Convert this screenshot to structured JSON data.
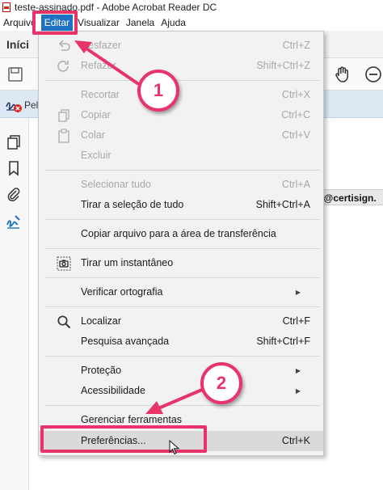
{
  "window": {
    "title": "teste-assinado.pdf - Adobe Acrobat Reader DC"
  },
  "menubar": {
    "items": [
      "Arquivo",
      "Editar",
      "Visualizar",
      "Janela",
      "Ajuda"
    ],
    "active": "Editar"
  },
  "toolbar": {
    "home_label": "Iníci",
    "sign_label": "Pel"
  },
  "document": {
    "email_fragment": "aro@certisign."
  },
  "dropdown": {
    "items": {
      "desfazer": {
        "label": "Desfazer",
        "shortcut": "Ctrl+Z"
      },
      "refazer": {
        "label": "Refazer",
        "shortcut": "Shift+Ctrl+Z"
      },
      "recortar": {
        "label": "Recortar",
        "shortcut": "Ctrl+X"
      },
      "copiar": {
        "label": "Copiar",
        "shortcut": "Ctrl+C"
      },
      "colar": {
        "label": "Colar",
        "shortcut": "Ctrl+V"
      },
      "excluir": {
        "label": "Excluir"
      },
      "selecionar_tudo": {
        "label": "Selecionar tudo",
        "shortcut": "Ctrl+A"
      },
      "tirar_selecao": {
        "label": "Tirar a seleção de tudo",
        "shortcut": "Shift+Ctrl+A"
      },
      "copiar_arquivo": {
        "label": "Copiar arquivo para a área de transferência"
      },
      "instantaneo": {
        "label": "Tirar um instantâneo"
      },
      "ortografia": {
        "label": "Verificar ortografia"
      },
      "localizar": {
        "label": "Localizar",
        "shortcut": "Ctrl+F"
      },
      "pesquisa": {
        "label": "Pesquisa avançada",
        "shortcut": "Shift+Ctrl+F"
      },
      "protecao": {
        "label": "Proteção"
      },
      "acessibilidade": {
        "label": "Acessibilidade"
      },
      "gerenciar": {
        "label": "Gerenciar ferramentas"
      },
      "preferencias": {
        "label": "Preferências...",
        "shortcut": "Ctrl+K"
      }
    }
  },
  "annotations": {
    "step1": "1",
    "step2": "2",
    "accent_color": "#e8346a"
  }
}
